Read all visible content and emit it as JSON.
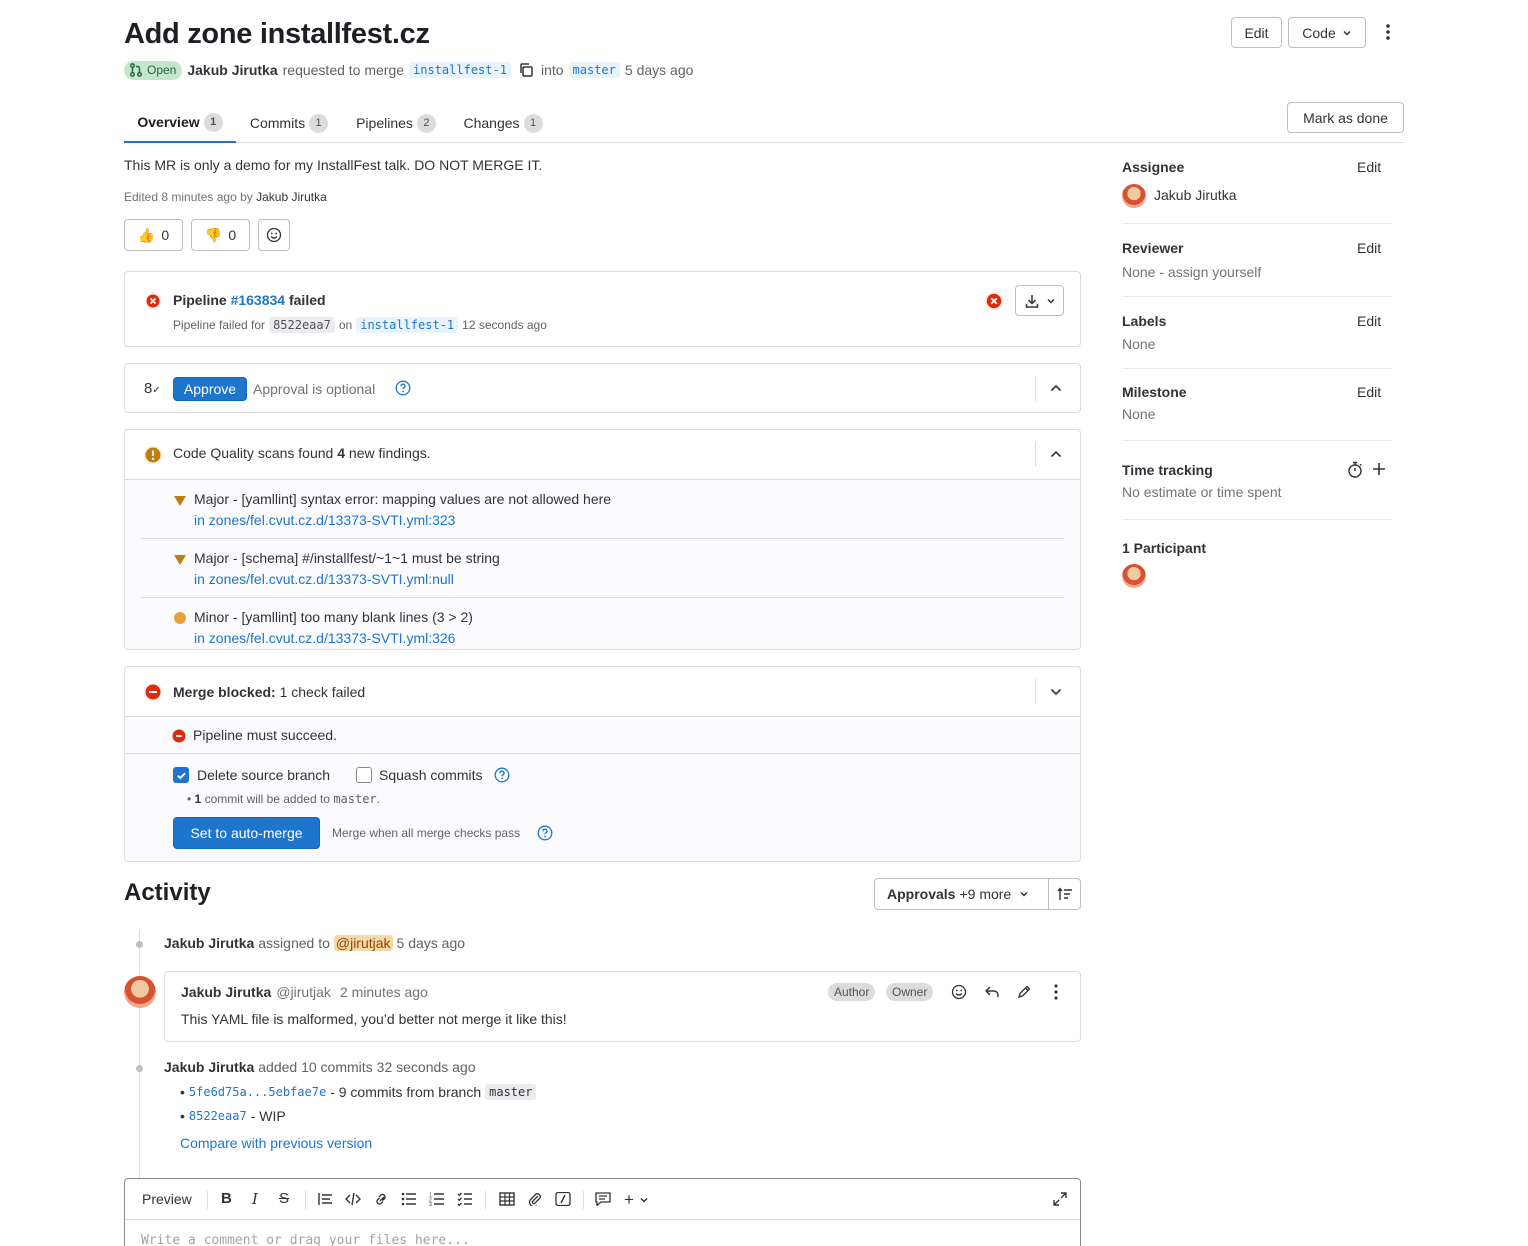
{
  "header": {
    "title": "Add zone installfest.cz",
    "status": "Open",
    "author": "Jakub Jirutka",
    "requested_text": "requested to merge",
    "source_branch": "installfest-1",
    "into_text": "into",
    "target_branch": "master",
    "time": "5 days ago",
    "edit_label": "Edit",
    "code_label": "Code"
  },
  "tabs": [
    {
      "label": "Overview",
      "count": "1"
    },
    {
      "label": "Commits",
      "count": "1"
    },
    {
      "label": "Pipelines",
      "count": "2"
    },
    {
      "label": "Changes",
      "count": "1"
    }
  ],
  "mark_done_label": "Mark as done",
  "description": {
    "text": "This MR is only a demo for my InstallFest talk. DO NOT MERGE IT.",
    "edited_prefix": "Edited 8 minutes ago by",
    "edited_by": "Jakub Jirutka",
    "thumbs_up": "0",
    "thumbs_down": "0"
  },
  "pipeline": {
    "label": "Pipeline",
    "id": "#163834",
    "status": "failed",
    "failed_for": "Pipeline failed for",
    "sha": "8522eaa7",
    "on": "on",
    "branch": "installfest-1",
    "time": "12 seconds ago"
  },
  "approval": {
    "button": "Approve",
    "text": "Approval is optional"
  },
  "code_quality": {
    "prefix": "Code Quality scans found",
    "count": "4",
    "suffix": "new findings.",
    "findings": [
      {
        "text": "Major - [yamllint] syntax error: mapping values are not allowed here",
        "link": "in zones/fel.cvut.cz.d/13373-SVTI.yml:323",
        "severity": "major"
      },
      {
        "text": "Major - [schema] #/installfest/~1~1 must be string",
        "link": "in zones/fel.cvut.cz.d/13373-SVTI.yml:null",
        "severity": "major"
      },
      {
        "text": "Minor - [yamllint] too many blank lines (3 > 2)",
        "link": "in zones/fel.cvut.cz.d/13373-SVTI.yml:326",
        "severity": "minor"
      }
    ]
  },
  "merge": {
    "blocked_label": "Merge blocked:",
    "blocked_text": "1 check failed",
    "check_text": "Pipeline must succeed.",
    "delete_branch_label": "Delete source branch",
    "delete_branch_checked": true,
    "squash_label": "Squash commits",
    "squash_checked": false,
    "commit_count": "1",
    "commit_text": "commit will be added to",
    "commit_target": "master",
    "auto_merge_button": "Set to auto-merge",
    "auto_merge_hint": "Merge when all merge checks pass"
  },
  "activity": {
    "title": "Activity",
    "filter_label": "Approvals",
    "filter_more": "+9 more",
    "items": {
      "assigned": {
        "author": "Jakub Jirutka",
        "text": "assigned to",
        "mention": "@jirutjak",
        "time": "5 days ago"
      },
      "comment": {
        "author": "Jakub Jirutka",
        "handle": "@jirutjak",
        "time": "2 minutes ago",
        "badge_author": "Author",
        "badge_owner": "Owner",
        "body": "This YAML file is malformed, you’d better not merge it like this!"
      },
      "commits": {
        "author": "Jakub Jirutka",
        "text": "added 10 commits",
        "time": "32 seconds ago",
        "range": "5fe6d75a...5ebfae7e",
        "range_text": "- 9 commits from branch",
        "range_branch": "master",
        "sha": "8522eaa7",
        "sha_text": "- WIP",
        "compare": "Compare with previous version"
      }
    }
  },
  "editor": {
    "preview_label": "Preview",
    "placeholder": "Write a comment or drag your files here..."
  },
  "sidebar": {
    "assignee_label": "Assignee",
    "assignee": "Jakub Jirutka",
    "reviewer_label": "Reviewer",
    "reviewer": "None - assign yourself",
    "labels_label": "Labels",
    "labels": "None",
    "milestone_label": "Milestone",
    "milestone": "None",
    "time_label": "Time tracking",
    "time_value": "No estimate or time spent",
    "participants_label": "1 Participant",
    "edit_label": "Edit"
  },
  "colors": {
    "link": "#1f75cb",
    "danger": "#dd2b0e",
    "warning": "#c17d10",
    "success_bg": "#c3e6cd",
    "success_text": "#24663b"
  }
}
